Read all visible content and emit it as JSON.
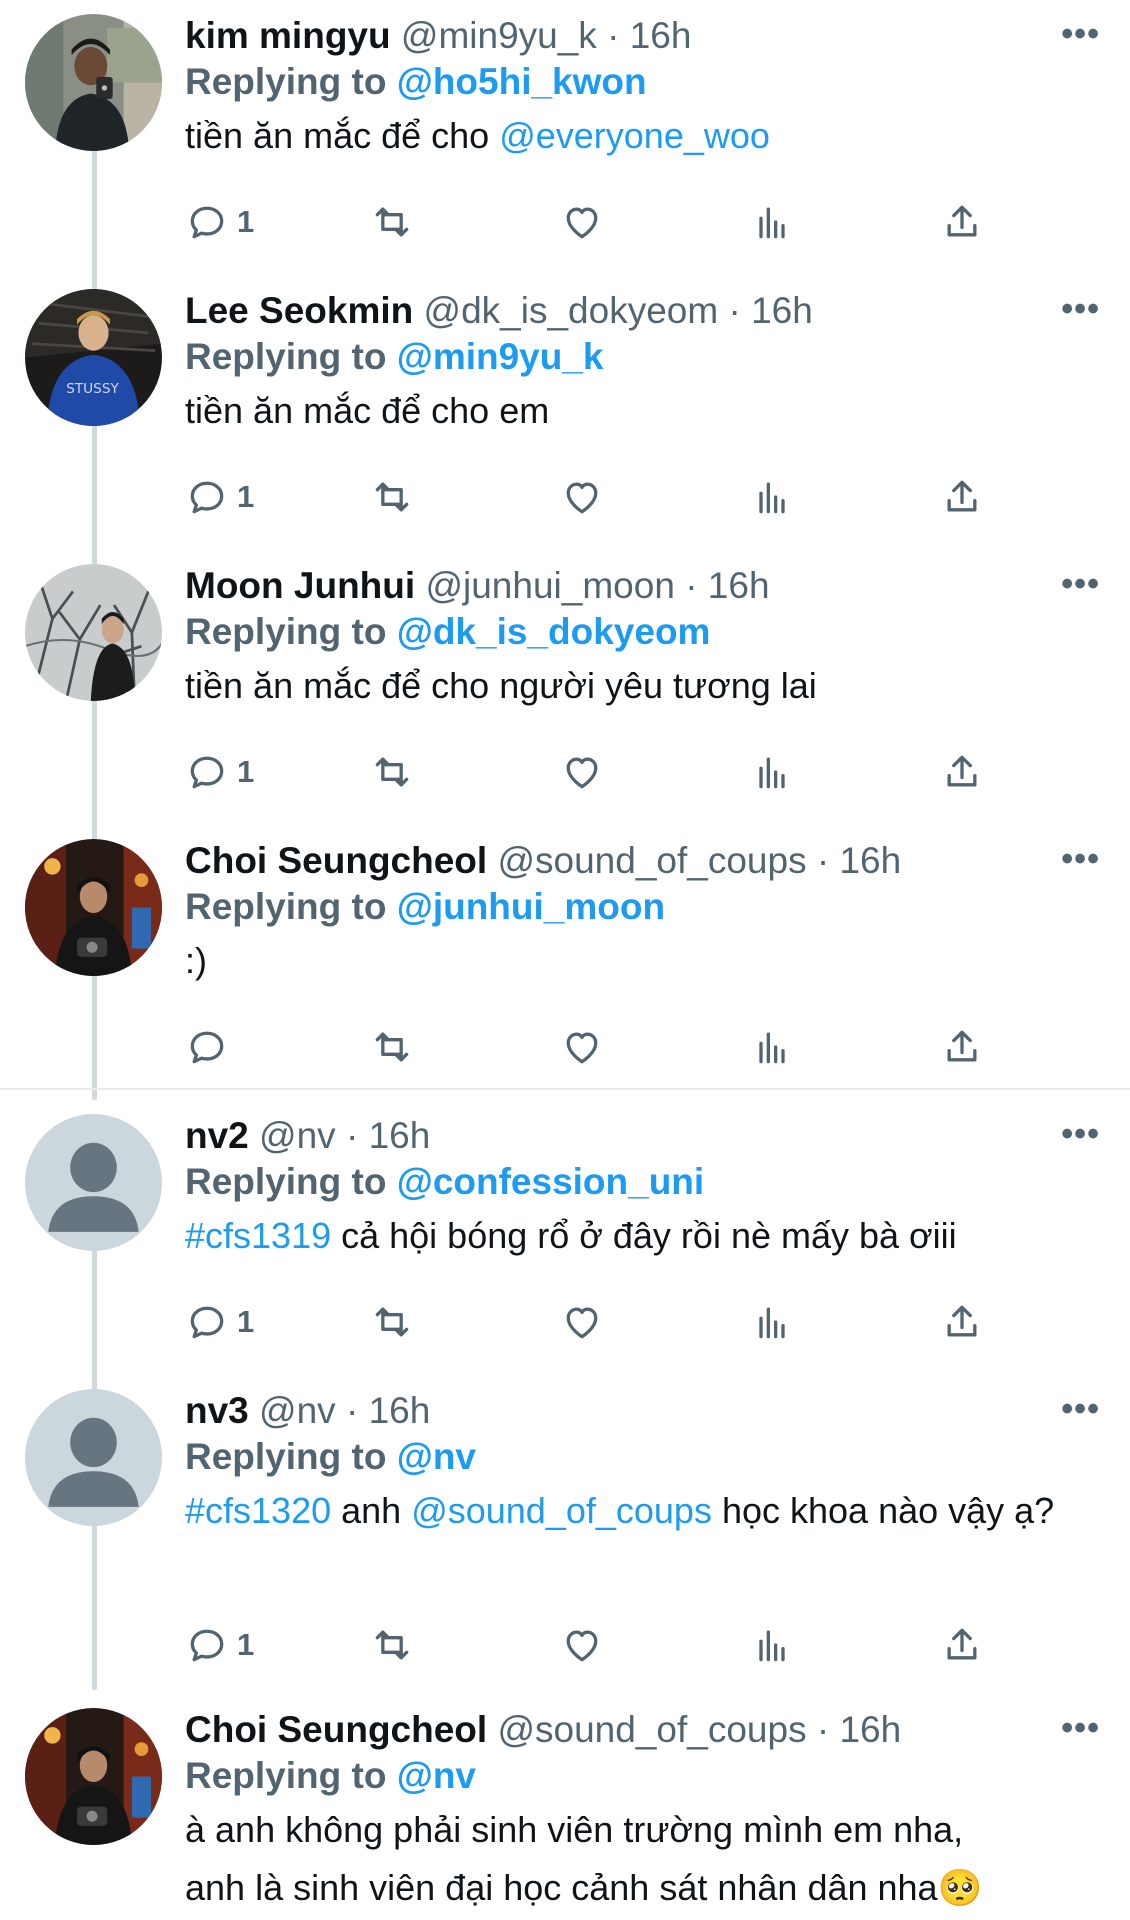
{
  "tweets": [
    {
      "name": "kim mingyu",
      "handle": "@min9yu_k",
      "time": "16h",
      "reply_prefix": "Replying to",
      "reply_to": "@ho5hi_kwon",
      "text": "tiền ăn mắc để cho ",
      "text_link": "@everyone_woo",
      "reply_count": "1",
      "avatar": "photo-man-mirror-selfie-icon"
    },
    {
      "name": "Lee Seokmin",
      "handle": "@dk_is_dokyeom",
      "time": "16h",
      "reply_prefix": "Replying to",
      "reply_to": "@min9yu_k",
      "text": "tiền ăn mắc để cho em",
      "reply_count": "1",
      "avatar": "photo-man-blue-jacket-icon"
    },
    {
      "name": "Moon Junhui",
      "handle": "@junhui_moon",
      "time": "16h",
      "reply_prefix": "Replying to",
      "reply_to": "@dk_is_dokyeom",
      "text": "tiền ăn mắc để cho người yêu tương lai",
      "reply_count": "1",
      "avatar": "photo-man-bare-trees-icon"
    },
    {
      "name": "Choi Seungcheol",
      "handle": "@sound_of_coups",
      "time": "16h",
      "reply_prefix": "Replying to",
      "reply_to": "@junhui_moon",
      "text": ":)",
      "reply_count": "",
      "avatar": "photo-man-camera-night-icon"
    },
    {
      "name": "nv2",
      "handle": "@nv",
      "time": "16h",
      "reply_prefix": "Replying to",
      "reply_to": "@confession_uni",
      "hashtag": "#cfs1319",
      "text": " cả hội bóng rổ ở đây rồi nè mấy bà ơiii",
      "reply_count": "1",
      "avatar": "default-avatar-icon"
    },
    {
      "name": "nv3",
      "handle": "@nv",
      "time": "16h",
      "reply_prefix": "Replying to",
      "reply_to": "@nv",
      "hashtag": "#cfs1320",
      "text_a": " anh ",
      "text_link": "@sound_of_coups",
      "text_b": " học khoa nào vậy ạ?",
      "reply_count": "1",
      "avatar": "default-avatar-icon"
    },
    {
      "name": "Choi Seungcheol",
      "handle": "@sound_of_coups",
      "time": "16h",
      "reply_prefix": "Replying to",
      "reply_to": "@nv",
      "text_line1": "à anh không phải sinh viên trường mình em nha,",
      "text_line2": "anh là sinh viên đại học cảnh sát nhân dân nha",
      "emoji": "🥺",
      "avatar": "photo-man-camera-night-icon"
    }
  ],
  "dot": "·",
  "more_label": "•••",
  "colors": {
    "accent": "#1d9bf0",
    "secondary": "#536471",
    "thread_line": "#cfd9de",
    "separator": "#e7e9ea"
  }
}
